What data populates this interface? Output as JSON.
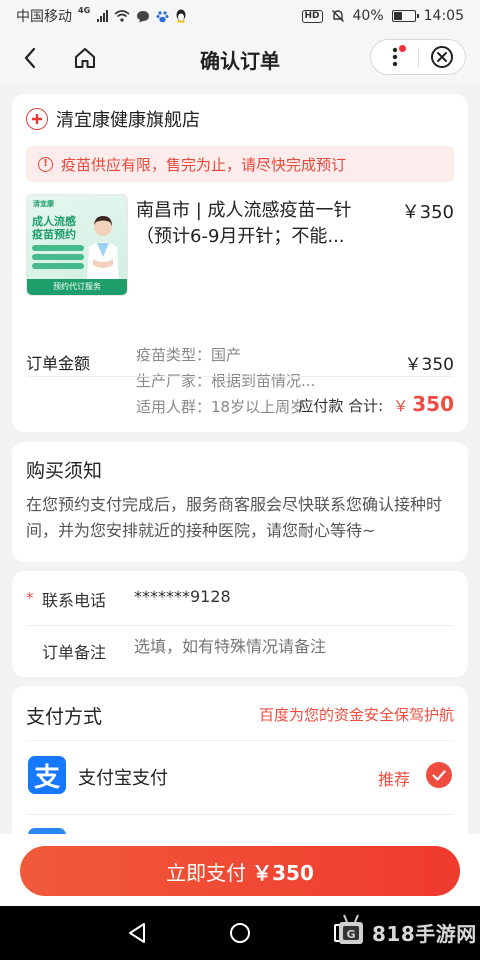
{
  "status_bar": {
    "carrier": "中国移动",
    "network": "4G",
    "time": "14:05",
    "battery": "40%",
    "battery_level": 0.4,
    "hd_label": "HD"
  },
  "header": {
    "title": "确认订单"
  },
  "shop": {
    "name": "清宜康健康旗舰店",
    "notice": "疫苗供应有限，售完为止，请尽快完成预订",
    "notice_icon": "!"
  },
  "product": {
    "name": "南昌市 | 成人流感疫苗一针（预计6-9月开针；不能...",
    "price": "￥350",
    "image": {
      "brand": "清宜康",
      "title_line1": "成人流感",
      "title_line2": "疫苗预约",
      "footer": "预约代订服务"
    },
    "attrs": [
      {
        "label": "疫苗类型：",
        "value": "国产"
      },
      {
        "label": "生产厂家：",
        "value": "根据到苗情况..."
      },
      {
        "label": "适用人群：",
        "value": "18岁以上周岁"
      }
    ]
  },
  "order": {
    "amount_label": "订单金额",
    "amount_value": "￥350",
    "payable_label": "应付款 合计:",
    "payable_symbol": "￥",
    "payable_value": "350"
  },
  "purchase_notice": {
    "title": "购买须知",
    "text": "在您预约支付完成后，服务商客服会尽快联系您确认接种时间，并为您安排就近的接种医院，请您耐心等待~"
  },
  "contact": {
    "required_mark": "*",
    "phone_label": "联系电话",
    "phone_value": "*******9128",
    "remark_label": "订单备注",
    "remark_placeholder": "选填，如有特殊情况请备注"
  },
  "payment": {
    "title": "支付方式",
    "safety_text": "百度为您的资金安全保驾护航",
    "options": [
      {
        "name": "支付宝支付",
        "logo_char": "支",
        "badge": "推荐",
        "selected": true
      }
    ]
  },
  "pay_button": {
    "label": "立即支付",
    "amount": "￥350"
  },
  "watermark": {
    "text": "818手游网",
    "logo_letter": "G"
  },
  "colors": {
    "accent": "#f04c3f",
    "alipay": "#1677ff",
    "product_green": "#1e9e6a"
  }
}
